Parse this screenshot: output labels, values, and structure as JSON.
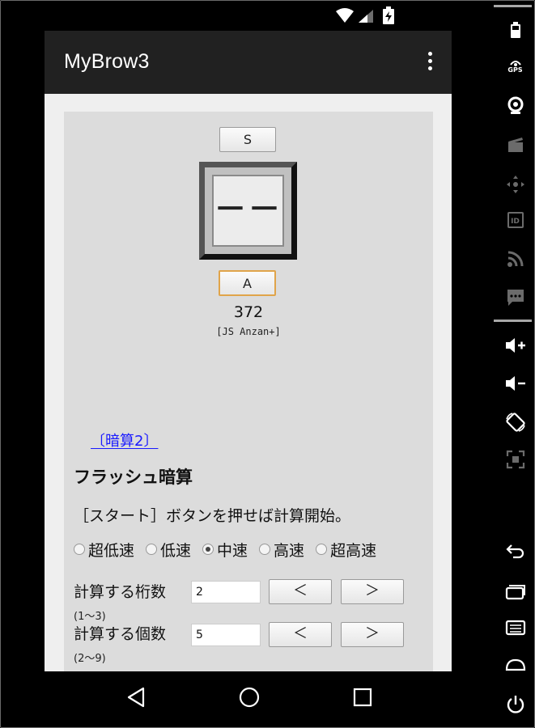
{
  "app": {
    "title": "MyBrow3"
  },
  "page": {
    "s_button": "S",
    "display": "－－",
    "a_button": "A",
    "counter": "372",
    "js_label": "[JS Anzan+]",
    "link": "〔暗算2〕",
    "section_title": "フラッシュ暗算",
    "instruction": "［スタート］ボタンを押せば計算開始。",
    "speed_options": [
      {
        "label": "超低速",
        "selected": false
      },
      {
        "label": "低速",
        "selected": false
      },
      {
        "label": "中速",
        "selected": true
      },
      {
        "label": "高速",
        "selected": false
      },
      {
        "label": "超高速",
        "selected": false
      }
    ],
    "digits": {
      "label": "計算する桁数",
      "value": "2",
      "hint": "(1～3)",
      "dec": "＜",
      "inc": "＞"
    },
    "count": {
      "label": "計算する個数",
      "value": "5",
      "hint": "(2～9)",
      "dec": "＜",
      "inc": "＞"
    }
  },
  "side_panel": {
    "icons": [
      "battery-icon",
      "gps-icon",
      "camera-icon",
      "clapperboard-icon",
      "dpad-icon",
      "id-icon",
      "rss-icon",
      "message-icon",
      "volume-up-icon",
      "volume-down-icon",
      "rotate-icon",
      "scale-icon",
      "back-icon",
      "recent-apps-icon",
      "menu-icon",
      "home-icon",
      "power-icon"
    ],
    "gps_label": "GPS",
    "id_label": "ID"
  },
  "nav_bar": {
    "icons": [
      "back-triangle-icon",
      "home-circle-icon",
      "recents-square-icon"
    ]
  },
  "colors": {
    "app_bar": "#212121",
    "link": "#1a1aff",
    "page_bg": "#dcdcdc",
    "accent_border": "#e0a44a"
  }
}
